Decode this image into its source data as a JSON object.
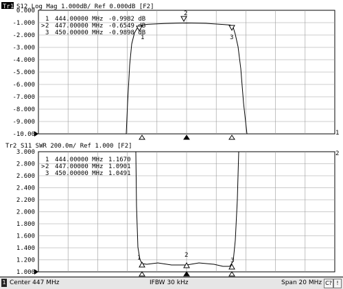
{
  "trace1": {
    "id": "Tr1",
    "header_text": "S12 Log Mag 1.000dB/ Ref 0.000dB [F2]",
    "y_ticks": [
      "0.000",
      "-1.000",
      "-2.000",
      "-3.000",
      "-4.000",
      "-5.000",
      "-6.000",
      "-7.000",
      "-8.000",
      "-9.000",
      "-10.00"
    ],
    "markers": [
      {
        "sel": " ",
        "num": "1",
        "freq": "444.00000 MHz",
        "val": "-0.9982 dB"
      },
      {
        "sel": ">",
        "num": "2",
        "freq": "447.00000 MHz",
        "val": "-0.6549 dB"
      },
      {
        "sel": " ",
        "num": "3",
        "freq": "450.00000 MHz",
        "val": "-0.9898 dB"
      }
    ],
    "right_label": "1"
  },
  "trace2": {
    "id": "Tr2",
    "header_text": "S11 SWR 200.0m/ Ref 1.000 [F2]",
    "y_ticks": [
      "3.000",
      "2.800",
      "2.600",
      "2.400",
      "2.200",
      "2.000",
      "1.800",
      "1.600",
      "1.400",
      "1.200",
      "1.000"
    ],
    "markers": [
      {
        "sel": " ",
        "num": "1",
        "freq": "444.00000 MHz",
        "val": "1.1670"
      },
      {
        "sel": ">",
        "num": "2",
        "freq": "447.00000 MHz",
        "val": "1.0901"
      },
      {
        "sel": " ",
        "num": "3",
        "freq": "450.00000 MHz",
        "val": "1.0491"
      }
    ],
    "right_label": "2"
  },
  "marker_labels": [
    "1",
    "2",
    "3"
  ],
  "status": {
    "channel": "1",
    "center": "Center 447 MHz",
    "ifbw": "IFBW 30 kHz",
    "span": "Span 20 MHz",
    "btn1": "C?",
    "btn2": "!"
  }
}
